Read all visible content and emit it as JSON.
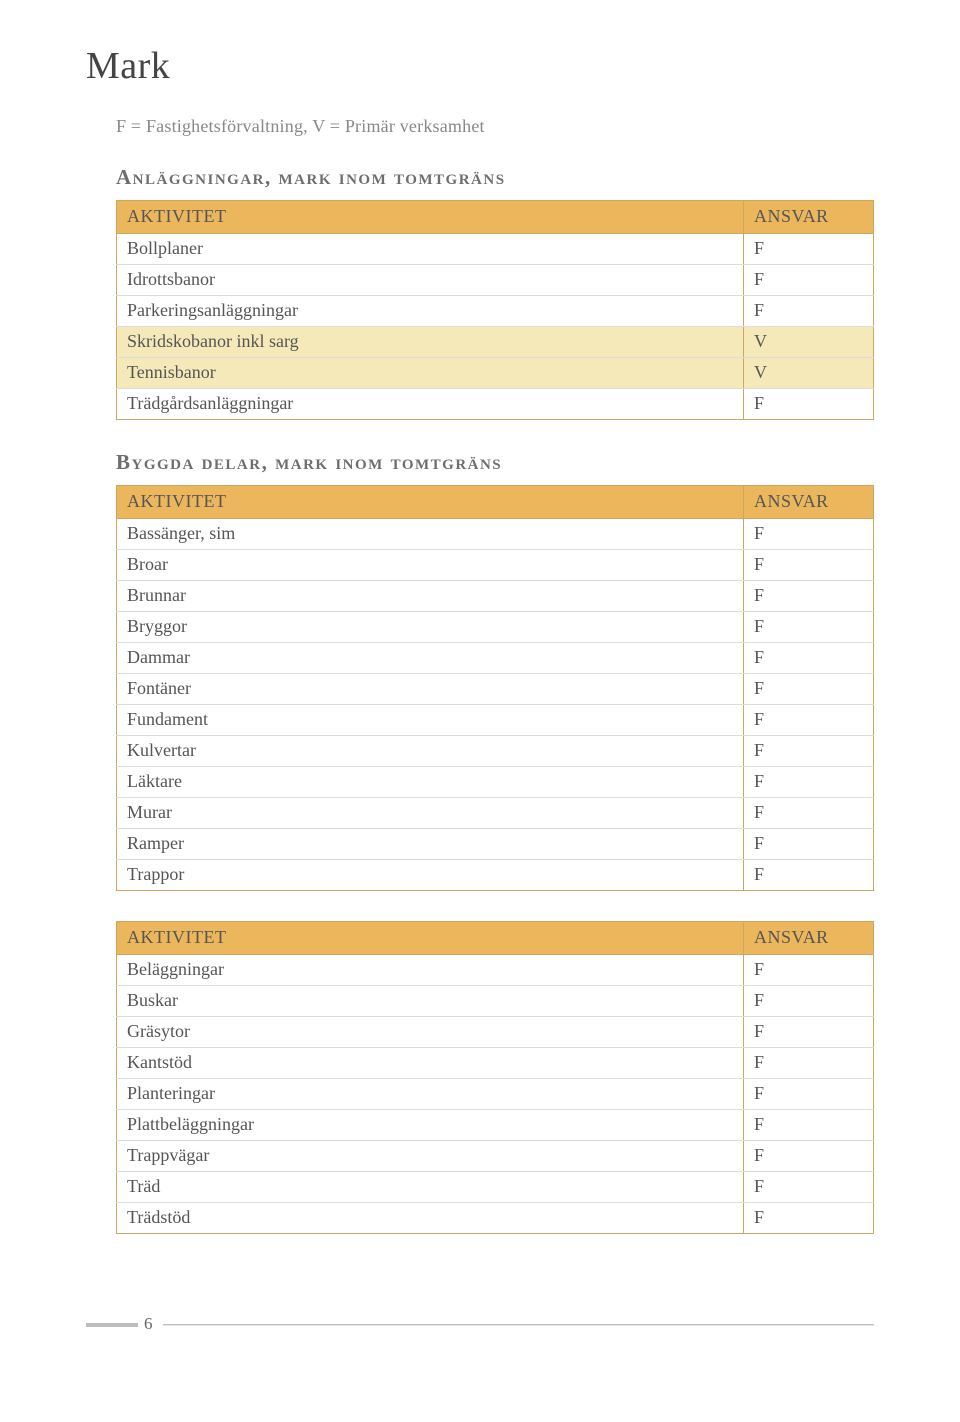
{
  "title": "Mark",
  "legend": "F = Fastighetsförvaltning, V = Primär verksamhet",
  "headers": {
    "aktivitet": "AKTIVITET",
    "ansvar": "ANSVAR"
  },
  "section1": {
    "heading": "Anläggningar, mark inom tomtgräns",
    "rows": [
      {
        "name": "Bollplaner",
        "val": "F",
        "hl": false
      },
      {
        "name": "Idrottsbanor",
        "val": "F",
        "hl": false
      },
      {
        "name": "Parkeringsanläggningar",
        "val": "F",
        "hl": false
      },
      {
        "name": "Skridskobanor inkl sarg",
        "val": "V",
        "hl": true
      },
      {
        "name": "Tennisbanor",
        "val": "V",
        "hl": true
      },
      {
        "name": "Trädgårdsanläggningar",
        "val": "F",
        "hl": false
      }
    ]
  },
  "section2": {
    "heading": "Byggda delar, mark inom tomtgräns",
    "rows": [
      {
        "name": "Bassänger, sim",
        "val": "F"
      },
      {
        "name": "Broar",
        "val": "F"
      },
      {
        "name": "Brunnar",
        "val": "F"
      },
      {
        "name": "Bryggor",
        "val": "F"
      },
      {
        "name": "Dammar",
        "val": "F"
      },
      {
        "name": "Fontäner",
        "val": "F"
      },
      {
        "name": "Fundament",
        "val": "F"
      },
      {
        "name": "Kulvertar",
        "val": "F"
      },
      {
        "name": "Läktare",
        "val": "F"
      },
      {
        "name": "Murar",
        "val": "F"
      },
      {
        "name": "Ramper",
        "val": "F"
      },
      {
        "name": "Trappor",
        "val": "F"
      }
    ]
  },
  "section3": {
    "rows": [
      {
        "name": "Beläggningar",
        "val": "F"
      },
      {
        "name": "Buskar",
        "val": "F"
      },
      {
        "name": "Gräsytor",
        "val": "F"
      },
      {
        "name": "Kantstöd",
        "val": "F"
      },
      {
        "name": "Planteringar",
        "val": "F"
      },
      {
        "name": "Plattbeläggningar",
        "val": "F"
      },
      {
        "name": "Trappvägar",
        "val": "F"
      },
      {
        "name": "Träd",
        "val": "F"
      },
      {
        "name": "Trädstöd",
        "val": "F"
      }
    ]
  },
  "pageNumber": "6"
}
